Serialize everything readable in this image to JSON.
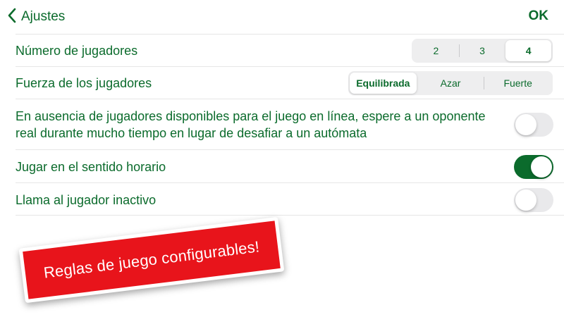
{
  "colors": {
    "accent": "#0b6b2c",
    "toggle_off": "#e9e9eb",
    "banner_bg": "#e8141b"
  },
  "nav": {
    "back_label": "Ajustes",
    "back_icon": "chevron-left-icon",
    "ok_label": "OK"
  },
  "settings": {
    "players_count": {
      "label": "Número de jugadores",
      "options": [
        "2",
        "3",
        "4"
      ],
      "selected": "4"
    },
    "player_strength": {
      "label": "Fuerza de los jugadores",
      "options": [
        "Equilibrada",
        "Azar",
        "Fuerte"
      ],
      "selected": "Equilibrada"
    },
    "wait_for_real_opponent": {
      "label": "En ausencia de jugadores disponibles para el juego en línea, espere a un oponente real durante mucho tiempo en lugar de desafiar a un autómata",
      "enabled": false
    },
    "clockwise": {
      "label": "Jugar en el sentido horario",
      "enabled": true
    },
    "call_inactive_player": {
      "label": "Llama al jugador inactivo",
      "enabled": false
    }
  },
  "banner": {
    "text": "Reglas de juego configurables!"
  }
}
